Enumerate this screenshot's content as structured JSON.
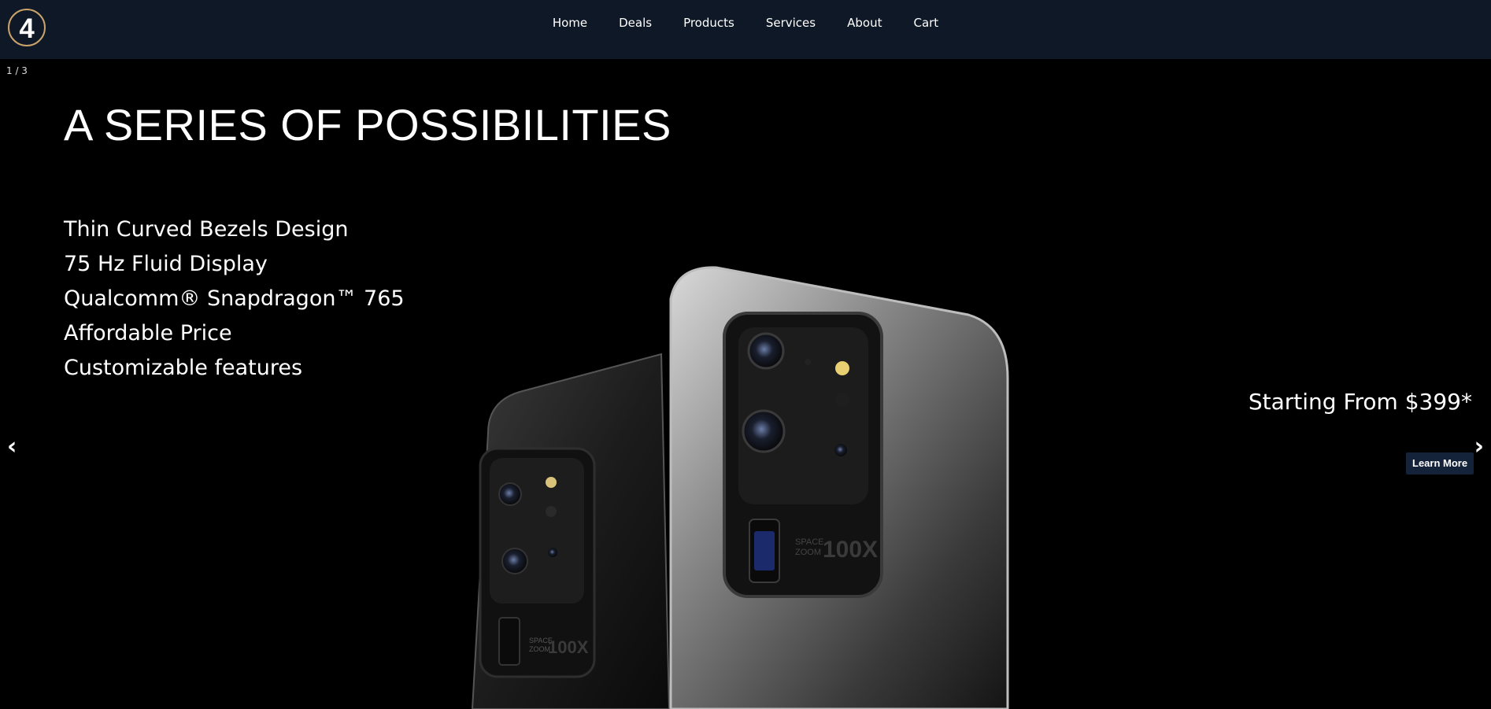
{
  "nav": {
    "logo_text": "4",
    "links": [
      "Home",
      "Deals",
      "Products",
      "Services",
      "About",
      "Cart"
    ]
  },
  "slider": {
    "counter": "1 / 3",
    "prev_symbol": "‹",
    "next_symbol": "›"
  },
  "hero": {
    "title": "A SERIES OF POSSIBILITIES",
    "features": [
      "Thin Curved Bezels Design",
      "75 Hz Fluid Display",
      "Qualcomm® Snapdragon™ 765",
      "Affordable Price",
      "Customizable features"
    ],
    "price": "Starting From $399*",
    "cta": "Learn More",
    "phone_label_line1": "SPACE",
    "phone_label_line2": "ZOOM",
    "phone_label_zoom": "100X"
  },
  "colors": {
    "nav_bg": "#0e1826",
    "page_bg": "#000000",
    "logo_ring": "#c9a36a",
    "button_bg": "#14233a"
  },
  "icons": {
    "logo": "circle-4-logo",
    "prev": "chevron-left-icon",
    "next": "chevron-right-icon"
  }
}
